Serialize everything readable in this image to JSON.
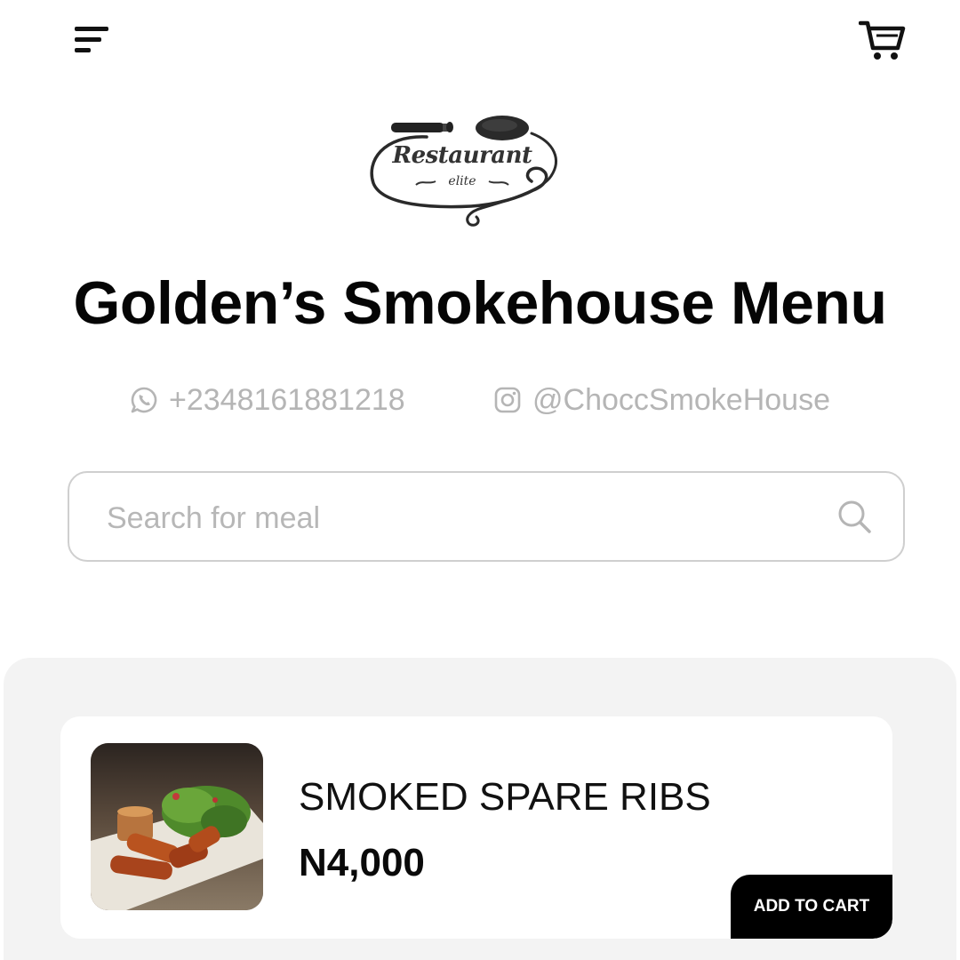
{
  "header": {
    "menu_icon": "hamburger-menu-icon",
    "cart_icon": "shopping-cart-icon"
  },
  "logo": {
    "word": "Restaurant",
    "sub": "elite"
  },
  "title": "Golden’s Smokehouse Menu",
  "contacts": {
    "phone": {
      "icon": "whatsapp-icon",
      "text": "+2348161881218"
    },
    "instagram": {
      "icon": "instagram-icon",
      "text": "@ChoccSmokeHouse"
    }
  },
  "search": {
    "placeholder": "Search for meal",
    "value": ""
  },
  "menu_items": [
    {
      "name": "SMOKED SPARE RIBS",
      "price": "N4,000",
      "button_label": "ADD TO CART"
    }
  ],
  "colors": {
    "text": "#0a0a0a",
    "muted": "#b5b5b5",
    "panel": "#f3f3f3",
    "button": "#000000"
  }
}
